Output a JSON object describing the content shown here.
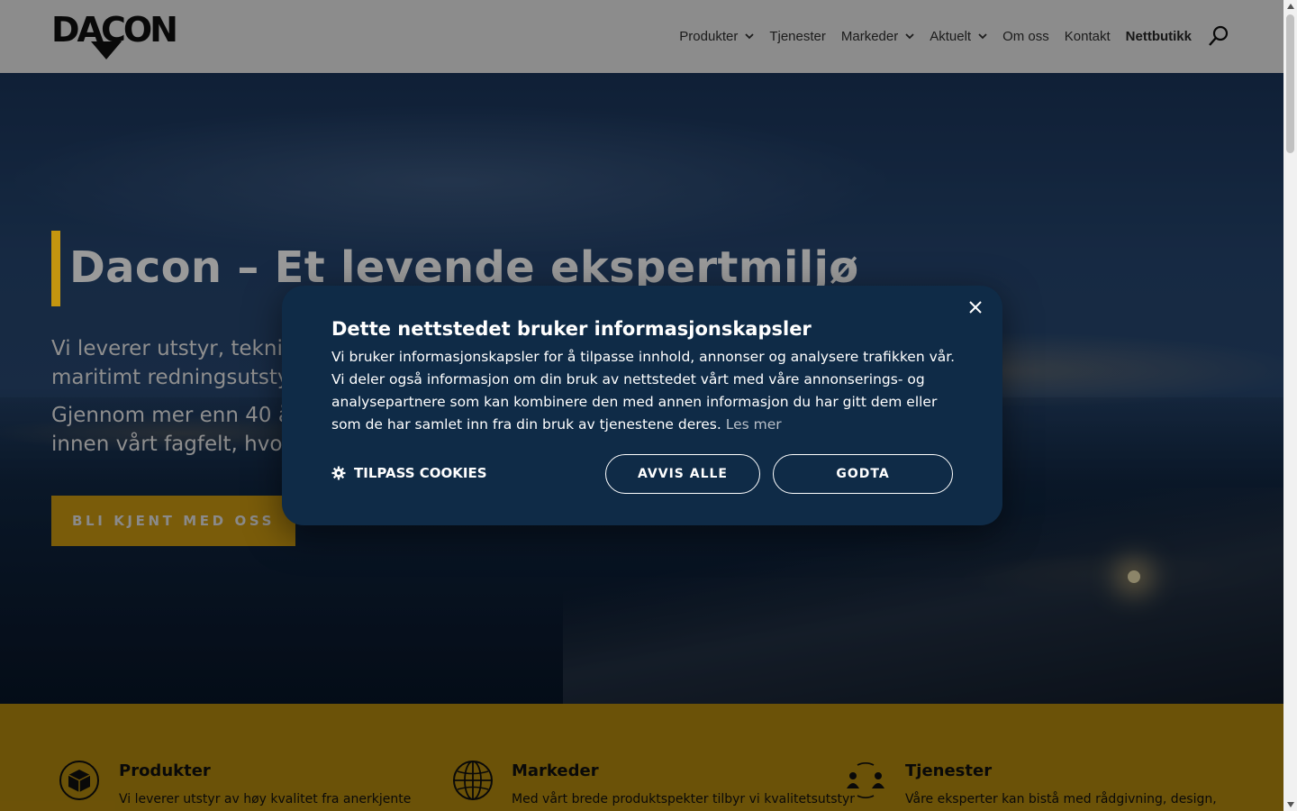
{
  "header": {
    "logo_text": "DACON",
    "nav": [
      {
        "label": "Produkter",
        "has_dropdown": true
      },
      {
        "label": "Tjenester",
        "has_dropdown": false
      },
      {
        "label": "Markeder",
        "has_dropdown": true
      },
      {
        "label": "Aktuelt",
        "has_dropdown": true
      },
      {
        "label": "Om oss",
        "has_dropdown": false
      },
      {
        "label": "Kontakt",
        "has_dropdown": false
      },
      {
        "label": "Nettbutikk",
        "has_dropdown": false
      }
    ],
    "search_icon": "search-icon"
  },
  "hero": {
    "title": "Dacon – Et levende ekspertmiljø",
    "text1": "Vi leverer utstyr, tekniske tjenester og kompetanse innen maritimt redningsutstyr, …",
    "text2": "Gjennom mer enn 40 år har vi bygget opp et ekspertmiljø innen vårt fagfelt, hvor vi tilbyr rådgivning …",
    "button_label": "BLI KJENT MED OSS"
  },
  "features": [
    {
      "icon": "box-icon",
      "title": "Produkter",
      "text": "Vi leverer utstyr av høy kvalitet fra anerkjente"
    },
    {
      "icon": "globe-icon",
      "title": "Markeder",
      "text": "Med vårt brede produktspekter tilbyr vi kvalitetsutstyr"
    },
    {
      "icon": "people-icon",
      "title": "Tjenester",
      "text": "Våre eksperter kan bistå med rådgivning, design,"
    }
  ],
  "cookie": {
    "title": "Dette nettstedet bruker informasjonskapsler",
    "body": "Vi bruker informasjonskapsler for å tilpasse innhold, annonser og analysere trafikken vår. Vi deler også informasjon om din bruk av nettstedet vårt med våre annonserings- og analysepartnere som kan kombinere den med annen informasjon du har gitt dem eller som de har samlet inn fra din bruk av tjenestene deres.",
    "link": "Les mer",
    "customize": "TILPASS COOKIES",
    "reject": "AVVIS ALLE",
    "accept": "GODTA"
  },
  "colors": {
    "accent": "#c4950f",
    "dialog_bg": "#0f2b47",
    "overlay": "rgba(0,0,0,0.45)"
  }
}
